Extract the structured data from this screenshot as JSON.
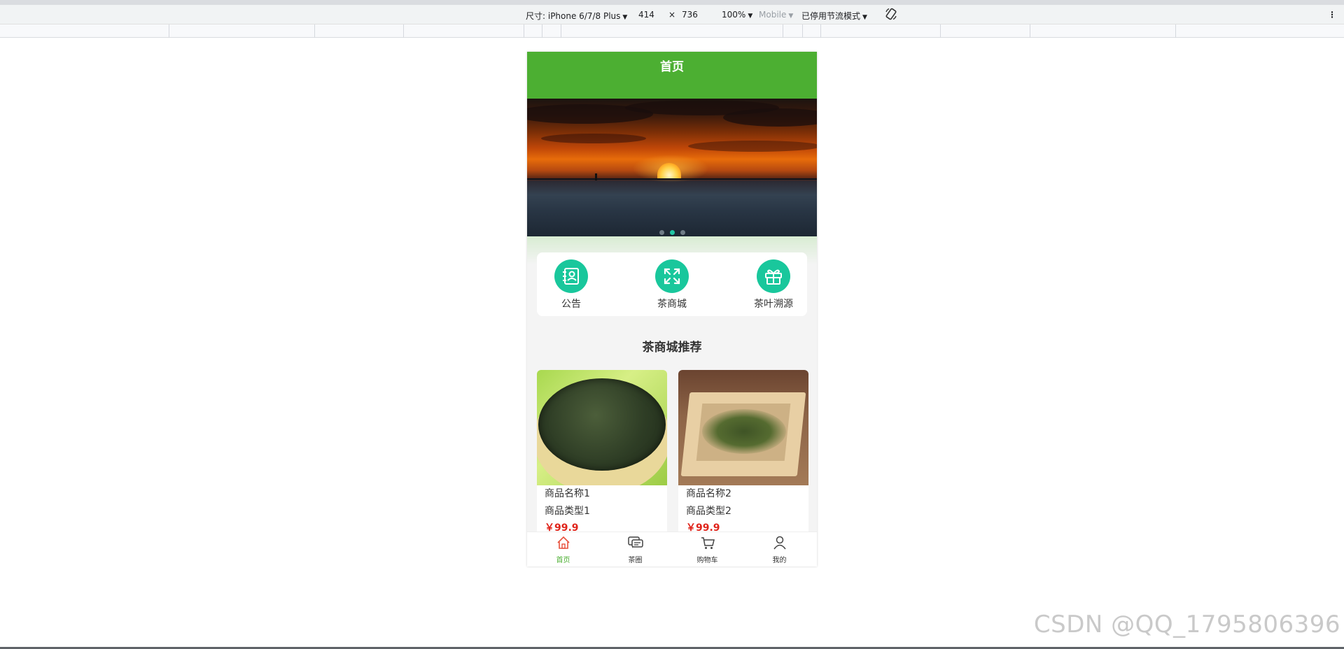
{
  "devtools": {
    "device_label": "尺寸: iPhone 6/7/8 Plus",
    "width": "414",
    "times": "×",
    "height": "736",
    "zoom": "100%",
    "mode": "Mobile",
    "throttle": "已停用节流模式"
  },
  "app": {
    "title": "首页",
    "banner": {
      "slides": 3,
      "active_slide": 2
    },
    "quicknav": [
      {
        "label": "公告",
        "icon": "notice-book-icon"
      },
      {
        "label": "茶商城",
        "icon": "expand-arrows-icon"
      },
      {
        "label": "茶叶溯源",
        "icon": "gift-box-icon"
      }
    ],
    "section_title": "茶商城推荐",
    "products": [
      {
        "name": "商品名称1",
        "type": "商品类型1",
        "price": "￥99.9"
      },
      {
        "name": "商品名称2",
        "type": "商品类型2",
        "price": "￥99.9"
      }
    ],
    "tabs": [
      {
        "label": "首页",
        "icon": "home-icon",
        "active": true
      },
      {
        "label": "茶圈",
        "icon": "chat-icon",
        "active": false
      },
      {
        "label": "购物车",
        "icon": "cart-icon",
        "active": false
      },
      {
        "label": "我的",
        "icon": "user-icon",
        "active": false
      }
    ],
    "colors": {
      "primary": "#4caf32",
      "accent": "#19c79c",
      "price": "#e0241b"
    }
  },
  "watermark": "CSDN @QQ_1795806396"
}
